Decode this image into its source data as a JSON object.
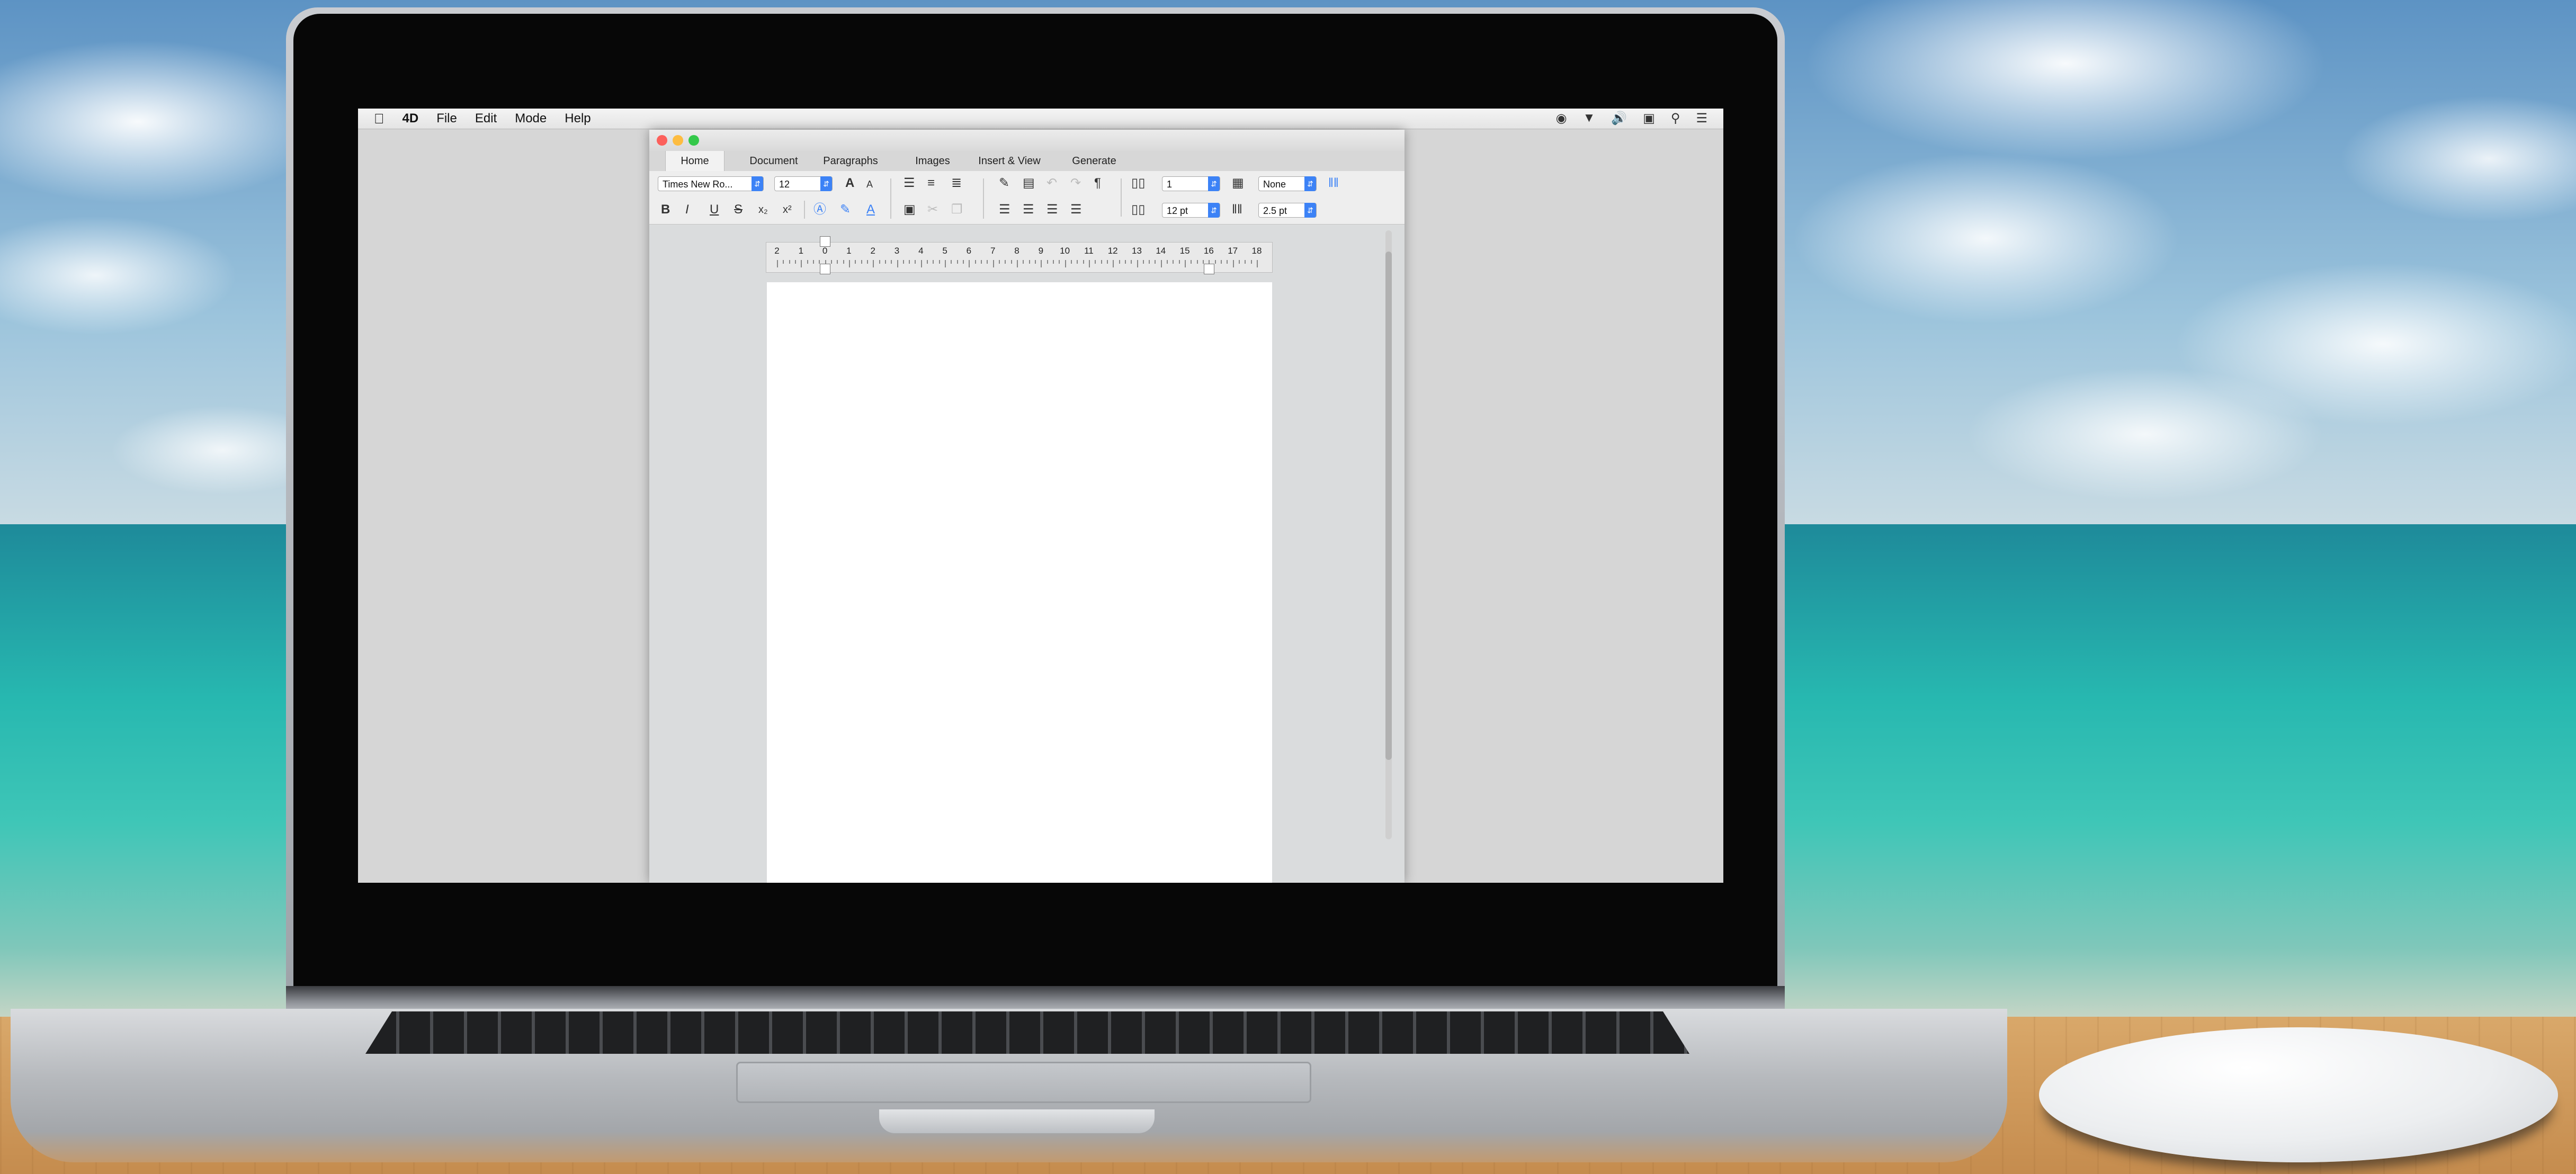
{
  "menubar": {
    "apple_icon": "apple-icon",
    "app_name": "4D",
    "items": [
      "File",
      "Edit",
      "Mode",
      "Help"
    ]
  },
  "status_icons": [
    "record-icon",
    "wifi-icon",
    "volume-icon",
    "display-icon",
    "search-icon",
    "list-icon"
  ],
  "window": {
    "traffic_lights": {
      "close": "#fc605b",
      "minimize": "#fdbc40",
      "zoom": "#34c84a"
    },
    "tabs": [
      "Home",
      "Document",
      "Paragraphs",
      "Images",
      "Insert & View",
      "Generate"
    ],
    "active_tab": "Home",
    "toolbar": {
      "font_name": "Times New Ro...",
      "font_size": "12",
      "bold": "B",
      "italic": "I",
      "underline": "U",
      "strike": "S",
      "subscript": "x₂",
      "superscript": "x²",
      "grow_font": "A",
      "shrink_font": "A",
      "text_color": "A",
      "pilcrow": "¶",
      "columns_value": "1",
      "column_spacing": "12 pt",
      "border_style": "None",
      "border_width": "2.5 pt"
    },
    "ruler_labels": [
      "2",
      "1",
      "0",
      "1",
      "2",
      "3",
      "4",
      "5",
      "6",
      "7",
      "8",
      "9",
      "10",
      "11",
      "12",
      "13",
      "14",
      "15",
      "16",
      "17",
      "18"
    ]
  },
  "colors": {
    "accent": "#3c82f6",
    "screen_bg": "#d6d6d6"
  }
}
